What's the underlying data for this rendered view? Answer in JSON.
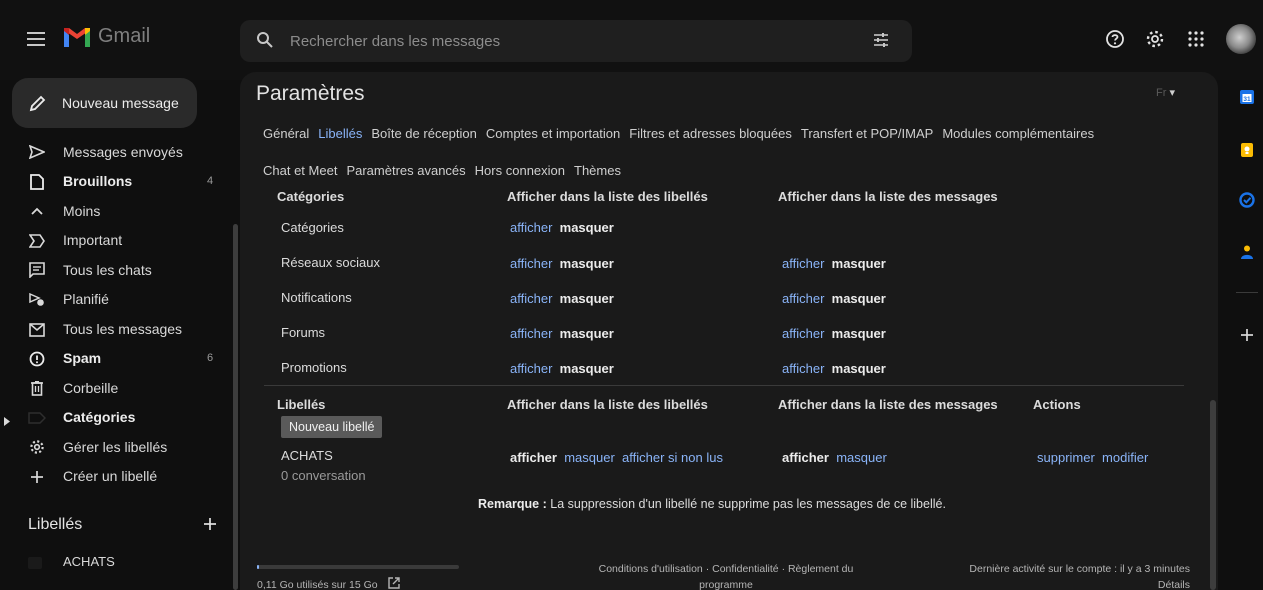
{
  "app": {
    "name": "Gmail"
  },
  "search": {
    "placeholder": "Rechercher dans les messages"
  },
  "compose": {
    "label": "Nouveau message"
  },
  "sidebar": {
    "items": [
      {
        "label": "Messages envoyés",
        "icon": "send-icon",
        "count": "",
        "bold": false
      },
      {
        "label": "Brouillons",
        "icon": "draft-icon",
        "count": "4",
        "bold": true
      },
      {
        "label": "Moins",
        "icon": "chevron-up-icon",
        "count": "",
        "bold": false
      },
      {
        "label": "Important",
        "icon": "important-icon",
        "count": "",
        "bold": false
      },
      {
        "label": "Tous les chats",
        "icon": "chat-icon",
        "count": "",
        "bold": false
      },
      {
        "label": "Planifié",
        "icon": "scheduled-icon",
        "count": "",
        "bold": false
      },
      {
        "label": "Tous les messages",
        "icon": "all-mail-icon",
        "count": "",
        "bold": false
      },
      {
        "label": "Spam",
        "icon": "spam-icon",
        "count": "6",
        "bold": true
      },
      {
        "label": "Corbeille",
        "icon": "trash-icon",
        "count": "",
        "bold": false
      },
      {
        "label": "Catégories",
        "icon": "label-icon",
        "count": "",
        "bold": true
      },
      {
        "label": "Gérer les libellés",
        "icon": "gear-icon",
        "count": "",
        "bold": false
      },
      {
        "label": "Créer un libellé",
        "icon": "plus-icon",
        "count": "",
        "bold": false
      }
    ],
    "labels_heading": "Libellés",
    "labels": [
      {
        "name": "ACHATS"
      }
    ]
  },
  "settings": {
    "title": "Paramètres",
    "language": "Fr",
    "tabs_row1": [
      "Général",
      "Libellés",
      "Boîte de réception",
      "Comptes et importation",
      "Filtres et adresses bloquées",
      "Transfert et POP/IMAP",
      "Modules complémentaires"
    ],
    "tabs_row2": [
      "Chat et Meet",
      "Paramètres avancés",
      "Hors connexion",
      "Thèmes"
    ],
    "active_tab": "Libellés",
    "categories": {
      "headers": [
        "Catégories",
        "Afficher dans la liste des libellés",
        "Afficher dans la liste des messages"
      ],
      "rows": [
        {
          "name": "Catégories",
          "list_show": "afficher",
          "list_hide": "masquer",
          "msg_show": "",
          "msg_hide": ""
        },
        {
          "name": "Réseaux sociaux",
          "list_show": "afficher",
          "list_hide": "masquer",
          "msg_show": "afficher",
          "msg_hide": "masquer"
        },
        {
          "name": "Notifications",
          "list_show": "afficher",
          "list_hide": "masquer",
          "msg_show": "afficher",
          "msg_hide": "masquer"
        },
        {
          "name": "Forums",
          "list_show": "afficher",
          "list_hide": "masquer",
          "msg_show": "afficher",
          "msg_hide": "masquer"
        },
        {
          "name": "Promotions",
          "list_show": "afficher",
          "list_hide": "masquer",
          "msg_show": "afficher",
          "msg_hide": "masquer"
        }
      ]
    },
    "labels": {
      "headers": [
        "Libellés",
        "Afficher dans la liste des libellés",
        "Afficher dans la liste des messages",
        "Actions"
      ],
      "new_label_button": "Nouveau libellé",
      "rows": [
        {
          "name": "ACHATS",
          "sub": "0 conversation",
          "list_show": "afficher",
          "list_hide": "masquer",
          "list_unread": "afficher si non lus",
          "msg_show": "afficher",
          "msg_hide": "masquer",
          "delete": "supprimer",
          "edit": "modifier"
        }
      ]
    },
    "note_bold": "Remarque :",
    "note_text": "La suppression d'un libellé ne supprime pas les messages de ce libellé."
  },
  "footer": {
    "storage": "0,11 Go utilisés sur 15 Go",
    "storage_used_fraction": 0.007,
    "links_line1": "Conditions d'utilisation · Confidentialité · Règlement du",
    "links_line2": "programme",
    "activity": "Dernière activité sur le compte : il y a 3 minutes",
    "details": "Détails"
  },
  "colors": {
    "link": "#8ab4f8",
    "background": "#0f0f0f",
    "panel": "#1a1a1a"
  }
}
